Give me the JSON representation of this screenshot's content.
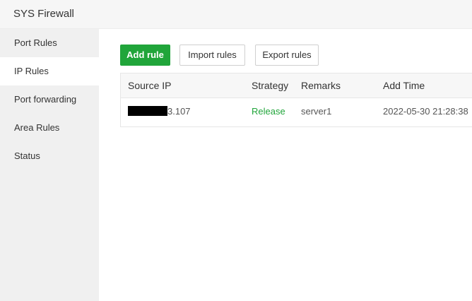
{
  "app": {
    "title": "SYS Firewall"
  },
  "sidebar": {
    "items": [
      {
        "label": "Port Rules",
        "active": false
      },
      {
        "label": "IP Rules",
        "active": true
      },
      {
        "label": "Port forwarding",
        "active": false
      },
      {
        "label": "Area Rules",
        "active": false
      },
      {
        "label": "Status",
        "active": false
      }
    ]
  },
  "toolbar": {
    "add_label": "Add rule",
    "import_label": "Import rules",
    "export_label": "Export rules"
  },
  "table": {
    "columns": [
      "Source IP",
      "Strategy",
      "Remarks",
      "Add Time"
    ],
    "rows": [
      {
        "source_ip_suffix": "3.107",
        "strategy": "Release",
        "remarks": "server1",
        "add_time": "2022-05-30 21:28:38"
      }
    ]
  },
  "colors": {
    "accent": "#20a53a",
    "sidebar_bg": "#f0f0f0",
    "header_bg": "#f6f6f6"
  }
}
